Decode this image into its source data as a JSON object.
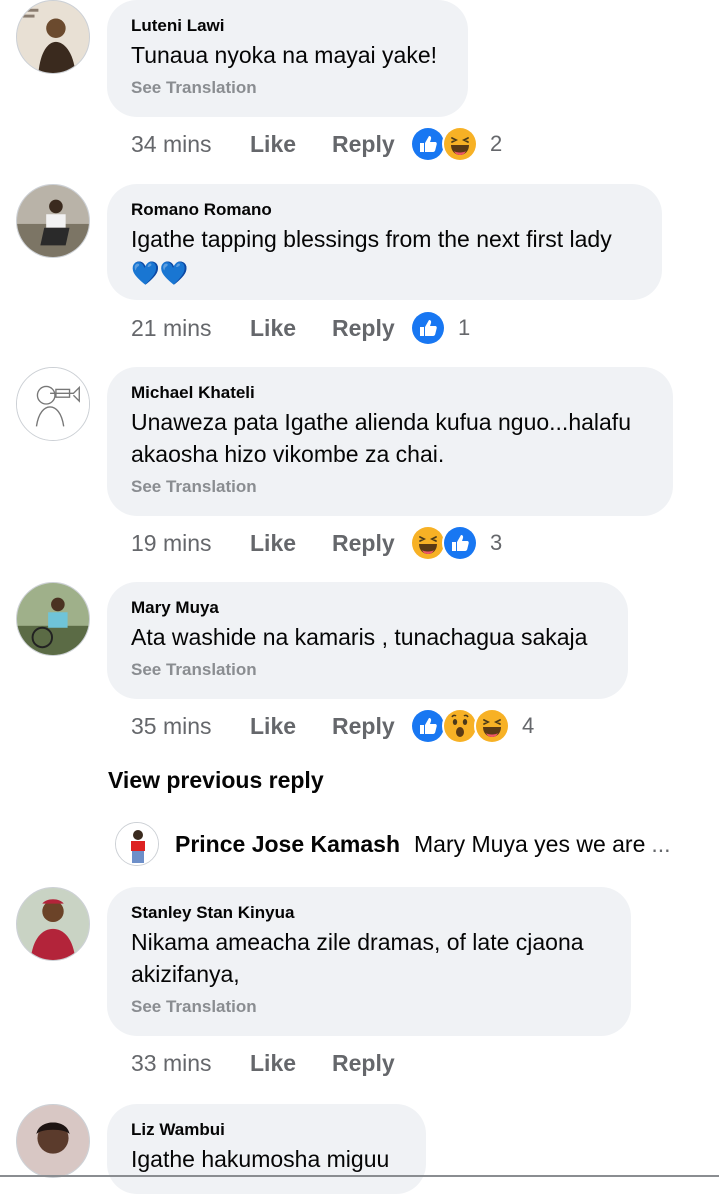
{
  "comments": [
    {
      "author": "Luteni Lawi",
      "text": "Tunaua nyoka na mayai yake!",
      "translation": "See Translation",
      "time": "34 mins",
      "like": "Like",
      "reply": "Reply",
      "reactions": [
        "like",
        "haha"
      ],
      "count": "2"
    },
    {
      "author": "Romano Romano",
      "text": "Igathe tapping blessings from the next first lady",
      "text2": "💙💙",
      "translation": "",
      "time": "21 mins",
      "like": "Like",
      "reply": "Reply",
      "reactions": [
        "like"
      ],
      "count": "1"
    },
    {
      "author": "Michael Khateli",
      "text": "Unaweza pata Igathe alienda kufua nguo...halafu",
      "text2": "akaosha hizo vikombe za chai.",
      "translation": "See Translation",
      "time": "19 mins",
      "like": "Like",
      "reply": "Reply",
      "reactions": [
        "haha",
        "like"
      ],
      "count": "3"
    },
    {
      "author": "Mary Muya",
      "text": "Ata washide na kamaris , tunachagua sakaja",
      "translation": "See Translation",
      "time": "35 mins",
      "like": "Like",
      "reply": "Reply",
      "reactions": [
        "like",
        "wow",
        "haha"
      ],
      "count": "4"
    },
    {
      "author": "Stanley Stan Kinyua",
      "text": "Nikama ameacha zile dramas, of late cjaona",
      "text2": "akizifanya,",
      "translation": "See Translation",
      "time": "33 mins",
      "like": "Like",
      "reply": "Reply",
      "reactions": [],
      "count": ""
    },
    {
      "author": "Liz Wambui",
      "text": "Igathe hakumosha miguu"
    }
  ],
  "view_previous_reply": "View previous reply",
  "reply_preview": {
    "name": "Prince Jose Kamash",
    "text": "Mary Muya yes we are",
    "ellipsis": "..."
  },
  "colors": {
    "bubble": "#f0f2f5",
    "like_blue": "#1877f2",
    "haha_yellow": "#f7b125",
    "meta_gray": "#65676b",
    "translation_gray": "#8a8d91"
  }
}
